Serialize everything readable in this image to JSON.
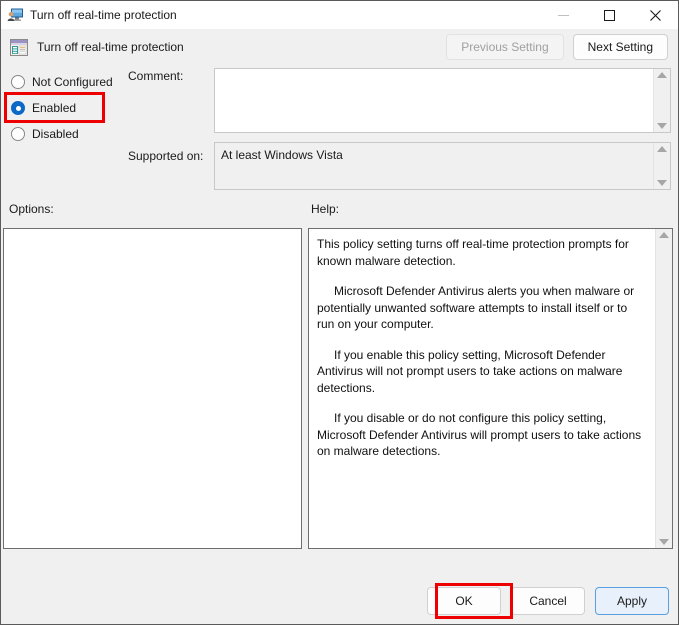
{
  "window": {
    "title": "Turn off real-time protection",
    "title_icon": "policy-user-monitor-icon",
    "caption": {
      "minimize_label": "–",
      "minimize_icon": "minimize-icon",
      "maximize_icon": "maximize-icon",
      "close_icon": "close-icon"
    }
  },
  "header": {
    "icon": "policy-setting-icon",
    "title": "Turn off real-time protection",
    "previous_setting_label": "Previous Setting",
    "previous_setting_disabled": true,
    "next_setting_label": "Next Setting",
    "next_setting_disabled": false
  },
  "state": {
    "options": [
      {
        "id": "not-configured",
        "label": "Not Configured",
        "selected": false
      },
      {
        "id": "enabled",
        "label": "Enabled",
        "selected": true
      },
      {
        "id": "disabled",
        "label": "Disabled",
        "selected": false
      }
    ],
    "selected_option": "Enabled"
  },
  "comment": {
    "label": "Comment:",
    "value": "",
    "placeholder": ""
  },
  "supported_on": {
    "label": "Supported on:",
    "value": "At least Windows Vista"
  },
  "options_panel": {
    "label": "Options:",
    "content": ""
  },
  "help_panel": {
    "label": "Help:",
    "paragraphs": [
      "This policy setting turns off real-time protection prompts for known malware detection.",
      "Microsoft Defender Antivirus alerts you when malware or potentially unwanted software attempts to install itself or to run on your computer.",
      "If you enable this policy setting, Microsoft Defender Antivirus will not prompt users to take actions on malware detections.",
      "If you disable or do not configure this policy setting, Microsoft Defender Antivirus will prompt users to take actions on malware detections."
    ],
    "paragraph_0": "This policy setting turns off real-time protection prompts for known malware detection.",
    "paragraph_1": "Microsoft Defender Antivirus alerts you when malware or potentially unwanted software attempts to install itself or to run on your computer.",
    "paragraph_2": "If you enable this policy setting, Microsoft Defender Antivirus will not prompt users to take actions on malware detections.",
    "paragraph_3": "If you disable or do not configure this policy setting, Microsoft Defender Antivirus will prompt users to take actions on malware detections."
  },
  "footer": {
    "ok_label": "OK",
    "cancel_label": "Cancel",
    "apply_label": "Apply"
  },
  "annotations": {
    "color": "#ee0000",
    "targets": [
      "Enabled",
      "OK"
    ]
  }
}
